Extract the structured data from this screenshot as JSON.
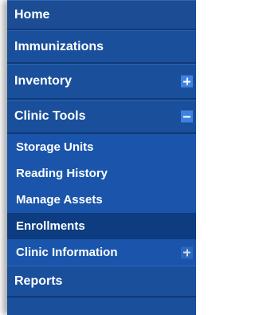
{
  "nav": {
    "home": "Home",
    "immunizations": "Immunizations",
    "inventory": "Inventory",
    "clinic_tools": "Clinic Tools",
    "sub_items": {
      "storage_units": "Storage Units",
      "reading_history": "Reading History",
      "manage_assets": "Manage Assets",
      "enrollments": "Enrollments",
      "clinic_information": "Clinic Information"
    },
    "reports": "Reports"
  },
  "icons": {
    "expand": "plus-square-icon",
    "collapse": "minus-square-icon"
  },
  "colors": {
    "nav_bg": "#1a4f9b",
    "active_bg": "#0d3d80",
    "toggle_bg": "#3d82e0"
  }
}
